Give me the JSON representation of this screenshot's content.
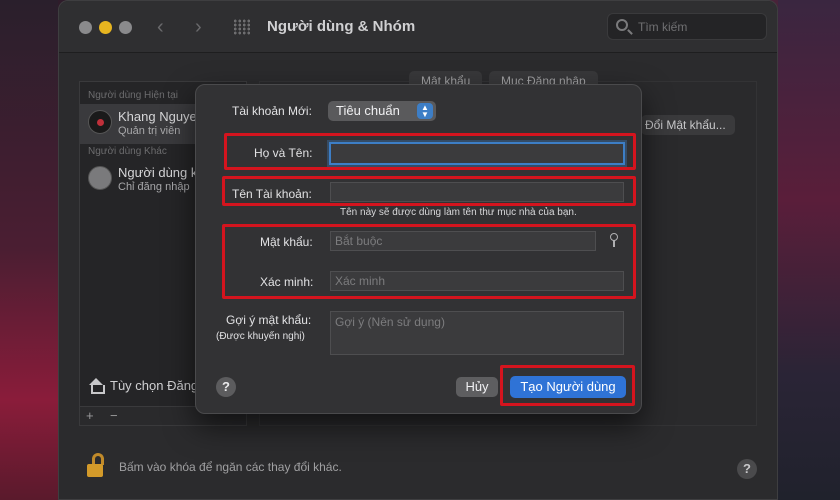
{
  "window": {
    "title": "Người dùng & Nhóm",
    "search_placeholder": "Tìm kiếm"
  },
  "sidebar": {
    "current_users_header": "Người dùng Hiện tại",
    "other_users_header": "Người dùng Khác",
    "users": [
      {
        "name": "Khang Nguyen",
        "role": "Quản trị viên"
      },
      {
        "name": "Người dùng khách",
        "role": "Chỉ đăng nhập"
      }
    ],
    "login_options": "Tùy chọn Đăng nhập",
    "add_symbol": "+",
    "remove_symbol": "−"
  },
  "background": {
    "tab_password": "Mật khẩu",
    "tab_login_items": "Mục Đăng nhập",
    "change_password_button": "Đổi Mật khẩu...",
    "lock_text": "Bấm vào khóa để ngăn các thay đổi khác."
  },
  "dialog": {
    "new_account_label": "Tài khoản Mới:",
    "new_account_value": "Tiêu chuẩn",
    "full_name_label": "Họ và Tên:",
    "full_name_value": "",
    "account_name_label": "Tên Tài khoản:",
    "account_name_value": "",
    "account_name_hint": "Tên này sẽ được dùng làm tên thư mục nhà của bạn.",
    "password_label": "Mật khẩu:",
    "password_placeholder": "Bắt buộc",
    "verify_label": "Xác minh:",
    "verify_placeholder": "Xác minh",
    "hint_label_1": "Gợi ý mật khẩu:",
    "hint_label_2": "(Được khuyến nghị)",
    "hint_placeholder": "Gợi ý (Nên sử dụng)",
    "help": "?",
    "cancel_button": "Hủy",
    "create_button": "Tạo Người dùng"
  },
  "colors": {
    "highlight": "#d4141e",
    "accent": "#2f73d6",
    "focus": "#3d7ec6"
  }
}
